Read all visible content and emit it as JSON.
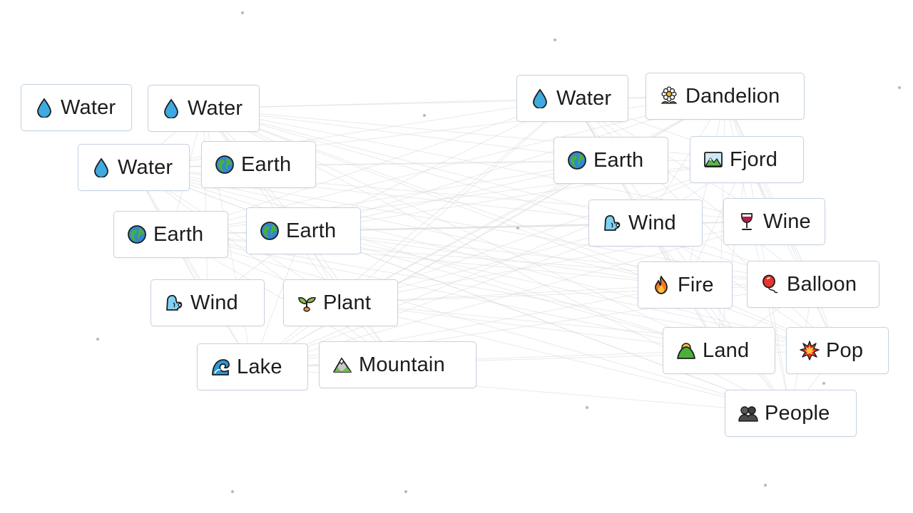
{
  "board": {
    "items": [
      {
        "id": "water-1",
        "label": "Water",
        "icon": "water-drop-icon"
      },
      {
        "id": "water-2",
        "label": "Water",
        "icon": "water-drop-icon"
      },
      {
        "id": "water-3",
        "label": "Water",
        "icon": "water-drop-icon"
      },
      {
        "id": "earth-1",
        "label": "Earth",
        "icon": "earth-globe-icon"
      },
      {
        "id": "earth-2",
        "label": "Earth",
        "icon": "earth-globe-icon"
      },
      {
        "id": "earth-3",
        "label": "Earth",
        "icon": "earth-globe-icon"
      },
      {
        "id": "wind-1",
        "label": "Wind",
        "icon": "wind-face-icon"
      },
      {
        "id": "plant-1",
        "label": "Plant",
        "icon": "seedling-icon"
      },
      {
        "id": "lake-1",
        "label": "Lake",
        "icon": "wave-icon"
      },
      {
        "id": "mountain-1",
        "label": "Mountain",
        "icon": "mountain-icon"
      },
      {
        "id": "water-4",
        "label": "Water",
        "icon": "water-drop-icon"
      },
      {
        "id": "dandelion-1",
        "label": "Dandelion",
        "icon": "flower-icon"
      },
      {
        "id": "earth-4",
        "label": "Earth",
        "icon": "earth-globe-icon"
      },
      {
        "id": "fjord-1",
        "label": "Fjord",
        "icon": "landscape-picture-icon"
      },
      {
        "id": "wind-2",
        "label": "Wind",
        "icon": "wind-face-icon"
      },
      {
        "id": "wine-1",
        "label": "Wine",
        "icon": "wine-glass-icon"
      },
      {
        "id": "fire-1",
        "label": "Fire",
        "icon": "fire-icon"
      },
      {
        "id": "balloon-1",
        "label": "Balloon",
        "icon": "balloon-icon"
      },
      {
        "id": "land-1",
        "label": "Land",
        "icon": "land-hill-icon"
      },
      {
        "id": "pop-1",
        "label": "Pop",
        "icon": "collision-icon"
      },
      {
        "id": "people-1",
        "label": "People",
        "icon": "people-silhouette-icon"
      }
    ]
  },
  "colors": {
    "item_border": "#c6d2e2",
    "text": "#1c1c1c",
    "line": "#d9d9d9",
    "dot": "#b8b8b8"
  }
}
